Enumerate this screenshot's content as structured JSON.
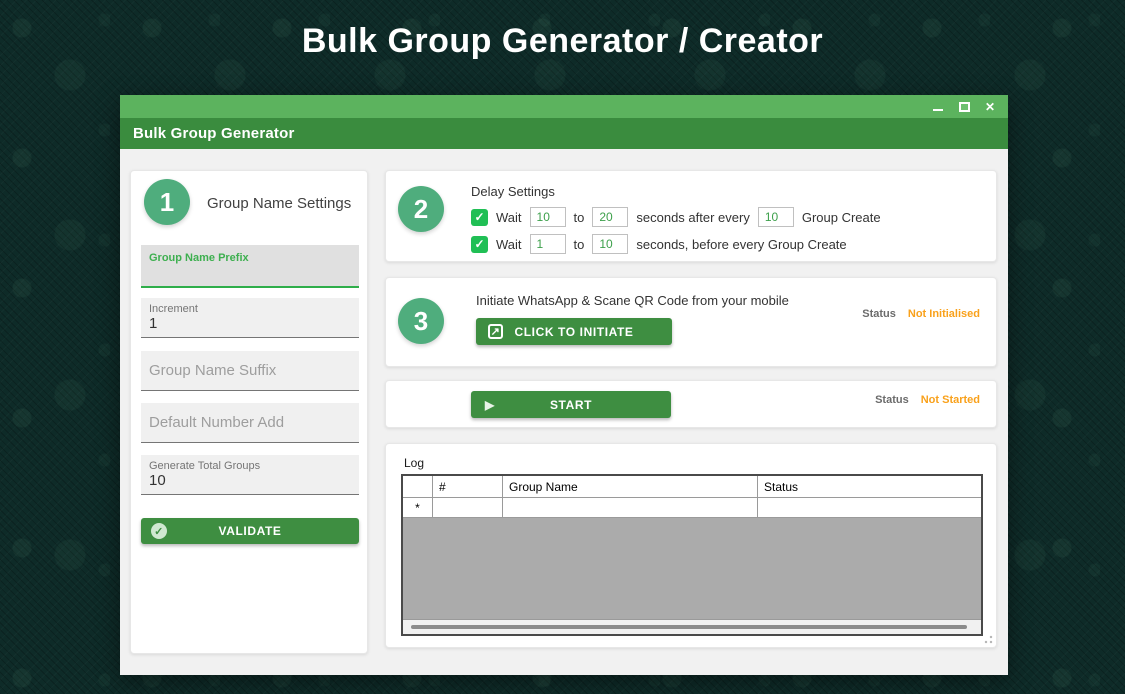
{
  "page": {
    "title": "Bulk Group Generator / Creator"
  },
  "window": {
    "title": "Bulk Group Generator"
  },
  "icons": {
    "close": "✕",
    "check": "✓",
    "launch": "↗",
    "play": "▶",
    "badge_check": "✓"
  },
  "step1": {
    "number": "1",
    "title": "Group Name Settings",
    "fields": {
      "prefix": {
        "label": "Group Name Prefix",
        "value": ""
      },
      "increment": {
        "label": "Increment",
        "value": "1"
      },
      "suffix": {
        "placeholder": "Group Name Suffix",
        "value": ""
      },
      "default_number": {
        "placeholder": "Default Number Add",
        "value": ""
      },
      "total_groups": {
        "label": "Generate Total Groups",
        "value": "10"
      }
    },
    "validate_button": "VALIDATE"
  },
  "step2": {
    "number": "2",
    "title": "Delay Settings",
    "row1": {
      "checked": true,
      "wait_label": "Wait",
      "from": "10",
      "to_label": "to",
      "to": "20",
      "middle_label": "seconds after every",
      "every": "10",
      "end_label": "Group Create"
    },
    "row2": {
      "checked": true,
      "wait_label": "Wait",
      "from": "1",
      "to_label": "to",
      "to": "10",
      "end_label": "seconds, before every Group Create"
    }
  },
  "step3": {
    "number": "3",
    "instruction": "Initiate WhatsApp & Scane QR Code from your mobile",
    "button": "CLICK TO INITIATE",
    "status_label": "Status",
    "status_value": "Not Initialised"
  },
  "start": {
    "button": "START",
    "status_label": "Status",
    "status_value": "Not Started"
  },
  "log": {
    "title": "Log",
    "columns": [
      "#",
      "Group Name",
      "Status"
    ],
    "new_row_marker": "*"
  },
  "colors": {
    "background": "#0e2b28",
    "window_strip": "#5cb35e",
    "window_titlebar": "#3a8c3e",
    "button_green": "#3e8e41",
    "step_circle": "#4fad7d",
    "checkbox_green": "#20bf55",
    "accent_text_green": "#3da04b",
    "status_orange": "#f9a11b",
    "grid_empty": "#ababab"
  }
}
